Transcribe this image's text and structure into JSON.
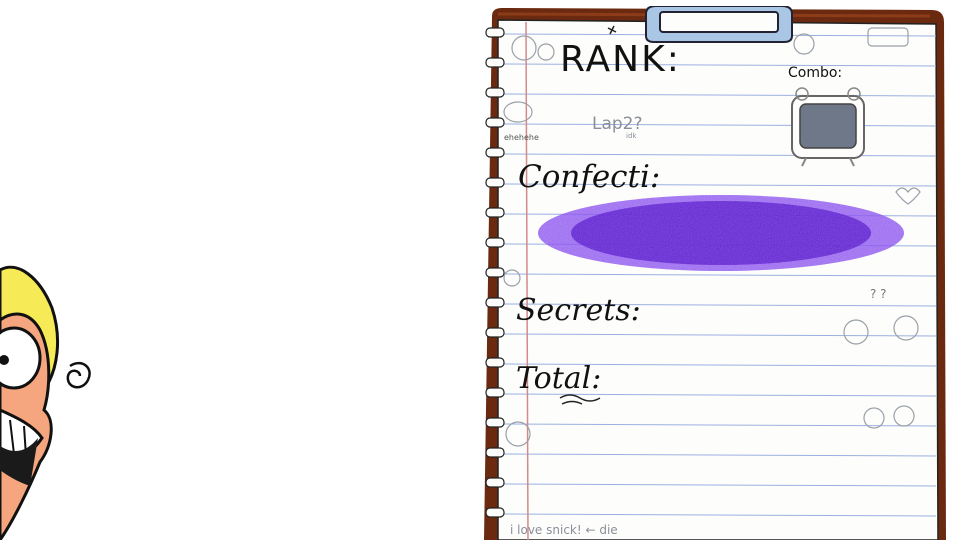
{
  "rank_card": {
    "rank_label": "RANK:",
    "combo_label": "Combo:",
    "lap_label": "Lap2?",
    "lap_note": "idk",
    "confecti_label": "Confecti:",
    "secrets_label": "Secrets:",
    "total_label": "Total:",
    "doodle_note": "ehehehe",
    "question_marks": "? ?",
    "footer_note": "i love snick! ← die"
  },
  "colors": {
    "clipboard_brown": "#6b2a10",
    "clip_blue": "#a9c6e4",
    "paper": "#fdfdfb",
    "rule_line": "#9bb0e0",
    "margin_line": "#d28a8a",
    "confecti_purple": "#5b22c9",
    "combo_screen": "#6f7888",
    "character_yellow": "#f7ea57",
    "character_skin": "#f6a67f"
  }
}
